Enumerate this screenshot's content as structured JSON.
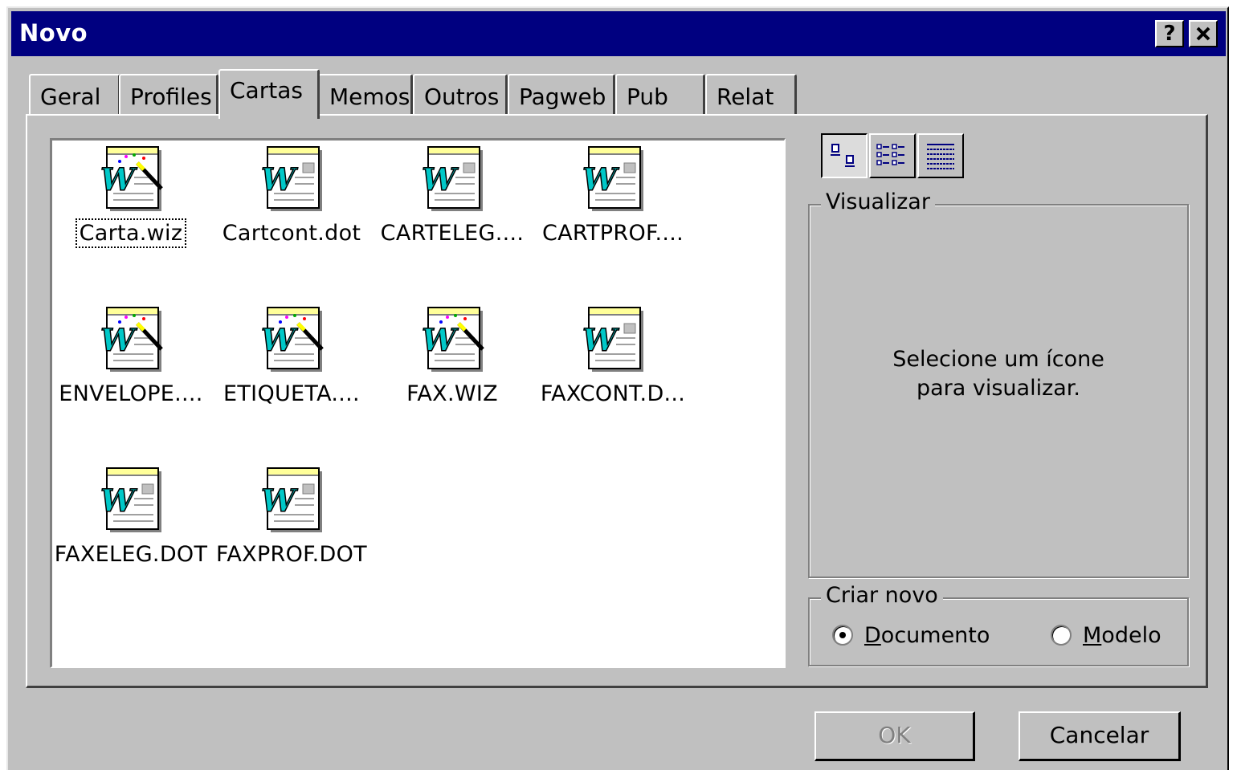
{
  "window": {
    "title": "Novo",
    "help_label": "?",
    "close_label": "✕"
  },
  "tabs": [
    {
      "label": "Geral"
    },
    {
      "label": "Profiles"
    },
    {
      "label": "Cartas"
    },
    {
      "label": "Memos"
    },
    {
      "label": "Outros"
    },
    {
      "label": "Pagweb"
    },
    {
      "label": "Pub"
    },
    {
      "label": "Relat"
    }
  ],
  "active_tab": "Cartas",
  "files": [
    {
      "label": "Carta.wiz",
      "icon": "word-wizard-icon"
    },
    {
      "label": "Cartcont.dot",
      "icon": "word-template-icon"
    },
    {
      "label": "CARTELEG....",
      "icon": "word-template-icon"
    },
    {
      "label": "CARTPROF....",
      "icon": "word-template-icon"
    },
    {
      "label": "ENVELOPE....",
      "icon": "word-wizard-icon"
    },
    {
      "label": "ETIQUETA....",
      "icon": "word-wizard-icon"
    },
    {
      "label": "FAX.WIZ",
      "icon": "word-wizard-icon"
    },
    {
      "label": "FAXCONT.D...",
      "icon": "word-template-icon"
    },
    {
      "label": "FAXELEG.DOT",
      "icon": "word-template-icon"
    },
    {
      "label": "FAXPROF.DOT",
      "icon": "word-template-icon"
    }
  ],
  "preview": {
    "legend": "Visualizar",
    "line1": "Selecione um ícone",
    "line2": "para visualizar."
  },
  "create_new": {
    "legend": "Criar novo",
    "documento_first": "D",
    "documento_rest": "ocumento",
    "modelo_first": "M",
    "modelo_rest": "odelo",
    "selected": "Documento"
  },
  "buttons": {
    "ok": "OK",
    "cancel": "Cancelar"
  }
}
